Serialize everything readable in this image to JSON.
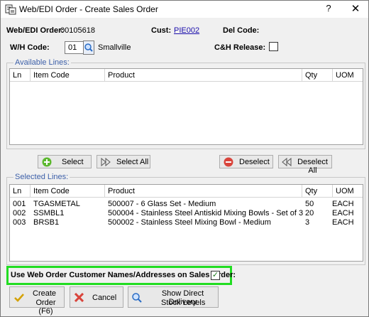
{
  "window": {
    "title": "Web/EDI Order - Create Sales Order",
    "help_label": "?",
    "close_label": "✕"
  },
  "header": {
    "order_label": "Web/EDI Order:",
    "order_value": "00105618",
    "cust_label": "Cust:",
    "cust_value": "PIE002",
    "del_code_label": "Del Code:",
    "wh_label": "W/H Code:",
    "wh_value": "01",
    "wh_name": "Smallville",
    "ch_release_label": "C&H Release:",
    "ch_release_checked": false
  },
  "available": {
    "legend": "Available Lines:",
    "columns": [
      "Ln",
      "Item Code",
      "Product",
      "Qty",
      "UOM"
    ],
    "rows": []
  },
  "actions": {
    "select": "Select",
    "select_all": "Select All",
    "deselect": "Deselect",
    "deselect_all": "Deselect All"
  },
  "selected": {
    "legend": "Selected Lines:",
    "columns": [
      "Ln",
      "Item Code",
      "Product",
      "Qty",
      "UOM"
    ],
    "rows": [
      {
        "ln": "001",
        "item": "TGASMETAL",
        "product": "500007 - 6 Glass Set - Medium",
        "qty": "50",
        "uom": "EACH"
      },
      {
        "ln": "002",
        "item": "SSMBL1",
        "product": "500004 - Stainless Steel Antiskid Mixing Bowls - Set of 3",
        "qty": "20",
        "uom": "EACH"
      },
      {
        "ln": "003",
        "item": "BRSB1",
        "product": "500002 - Stainless Steel Mixing Bowl - Medium",
        "qty": "3",
        "uom": "EACH"
      }
    ]
  },
  "option": {
    "label": "Use Web Order Customer Names/Addresses on Sales Order:",
    "checked": true,
    "check_mark": "✓"
  },
  "footer": {
    "create_line1": "Create",
    "create_line2": "Order (F6)",
    "cancel": "Cancel",
    "show_line1": "Show Direct Delivery",
    "show_line2": "Stock Levels"
  },
  "colors": {
    "highlight": "#22dd22",
    "legend": "#3c5fa8",
    "link": "#1a0dab"
  }
}
